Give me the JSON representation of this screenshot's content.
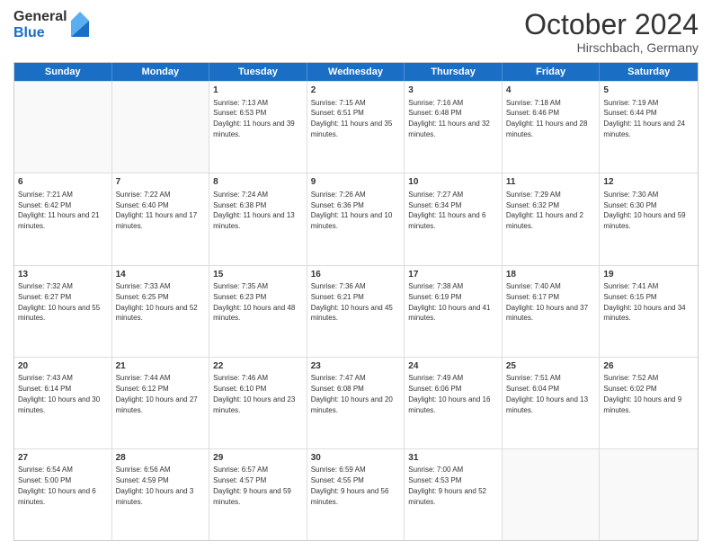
{
  "logo": {
    "general": "General",
    "blue": "Blue"
  },
  "header": {
    "month": "October 2024",
    "location": "Hirschbach, Germany"
  },
  "days": [
    "Sunday",
    "Monday",
    "Tuesday",
    "Wednesday",
    "Thursday",
    "Friday",
    "Saturday"
  ],
  "weeks": [
    [
      {
        "day": "",
        "empty": true
      },
      {
        "day": "",
        "empty": true
      },
      {
        "day": "1",
        "sunrise": "Sunrise: 7:13 AM",
        "sunset": "Sunset: 6:53 PM",
        "daylight": "Daylight: 11 hours and 39 minutes."
      },
      {
        "day": "2",
        "sunrise": "Sunrise: 7:15 AM",
        "sunset": "Sunset: 6:51 PM",
        "daylight": "Daylight: 11 hours and 35 minutes."
      },
      {
        "day": "3",
        "sunrise": "Sunrise: 7:16 AM",
        "sunset": "Sunset: 6:48 PM",
        "daylight": "Daylight: 11 hours and 32 minutes."
      },
      {
        "day": "4",
        "sunrise": "Sunrise: 7:18 AM",
        "sunset": "Sunset: 6:46 PM",
        "daylight": "Daylight: 11 hours and 28 minutes."
      },
      {
        "day": "5",
        "sunrise": "Sunrise: 7:19 AM",
        "sunset": "Sunset: 6:44 PM",
        "daylight": "Daylight: 11 hours and 24 minutes."
      }
    ],
    [
      {
        "day": "6",
        "sunrise": "Sunrise: 7:21 AM",
        "sunset": "Sunset: 6:42 PM",
        "daylight": "Daylight: 11 hours and 21 minutes."
      },
      {
        "day": "7",
        "sunrise": "Sunrise: 7:22 AM",
        "sunset": "Sunset: 6:40 PM",
        "daylight": "Daylight: 11 hours and 17 minutes."
      },
      {
        "day": "8",
        "sunrise": "Sunrise: 7:24 AM",
        "sunset": "Sunset: 6:38 PM",
        "daylight": "Daylight: 11 hours and 13 minutes."
      },
      {
        "day": "9",
        "sunrise": "Sunrise: 7:26 AM",
        "sunset": "Sunset: 6:36 PM",
        "daylight": "Daylight: 11 hours and 10 minutes."
      },
      {
        "day": "10",
        "sunrise": "Sunrise: 7:27 AM",
        "sunset": "Sunset: 6:34 PM",
        "daylight": "Daylight: 11 hours and 6 minutes."
      },
      {
        "day": "11",
        "sunrise": "Sunrise: 7:29 AM",
        "sunset": "Sunset: 6:32 PM",
        "daylight": "Daylight: 11 hours and 2 minutes."
      },
      {
        "day": "12",
        "sunrise": "Sunrise: 7:30 AM",
        "sunset": "Sunset: 6:30 PM",
        "daylight": "Daylight: 10 hours and 59 minutes."
      }
    ],
    [
      {
        "day": "13",
        "sunrise": "Sunrise: 7:32 AM",
        "sunset": "Sunset: 6:27 PM",
        "daylight": "Daylight: 10 hours and 55 minutes."
      },
      {
        "day": "14",
        "sunrise": "Sunrise: 7:33 AM",
        "sunset": "Sunset: 6:25 PM",
        "daylight": "Daylight: 10 hours and 52 minutes."
      },
      {
        "day": "15",
        "sunrise": "Sunrise: 7:35 AM",
        "sunset": "Sunset: 6:23 PM",
        "daylight": "Daylight: 10 hours and 48 minutes."
      },
      {
        "day": "16",
        "sunrise": "Sunrise: 7:36 AM",
        "sunset": "Sunset: 6:21 PM",
        "daylight": "Daylight: 10 hours and 45 minutes."
      },
      {
        "day": "17",
        "sunrise": "Sunrise: 7:38 AM",
        "sunset": "Sunset: 6:19 PM",
        "daylight": "Daylight: 10 hours and 41 minutes."
      },
      {
        "day": "18",
        "sunrise": "Sunrise: 7:40 AM",
        "sunset": "Sunset: 6:17 PM",
        "daylight": "Daylight: 10 hours and 37 minutes."
      },
      {
        "day": "19",
        "sunrise": "Sunrise: 7:41 AM",
        "sunset": "Sunset: 6:15 PM",
        "daylight": "Daylight: 10 hours and 34 minutes."
      }
    ],
    [
      {
        "day": "20",
        "sunrise": "Sunrise: 7:43 AM",
        "sunset": "Sunset: 6:14 PM",
        "daylight": "Daylight: 10 hours and 30 minutes."
      },
      {
        "day": "21",
        "sunrise": "Sunrise: 7:44 AM",
        "sunset": "Sunset: 6:12 PM",
        "daylight": "Daylight: 10 hours and 27 minutes."
      },
      {
        "day": "22",
        "sunrise": "Sunrise: 7:46 AM",
        "sunset": "Sunset: 6:10 PM",
        "daylight": "Daylight: 10 hours and 23 minutes."
      },
      {
        "day": "23",
        "sunrise": "Sunrise: 7:47 AM",
        "sunset": "Sunset: 6:08 PM",
        "daylight": "Daylight: 10 hours and 20 minutes."
      },
      {
        "day": "24",
        "sunrise": "Sunrise: 7:49 AM",
        "sunset": "Sunset: 6:06 PM",
        "daylight": "Daylight: 10 hours and 16 minutes."
      },
      {
        "day": "25",
        "sunrise": "Sunrise: 7:51 AM",
        "sunset": "Sunset: 6:04 PM",
        "daylight": "Daylight: 10 hours and 13 minutes."
      },
      {
        "day": "26",
        "sunrise": "Sunrise: 7:52 AM",
        "sunset": "Sunset: 6:02 PM",
        "daylight": "Daylight: 10 hours and 9 minutes."
      }
    ],
    [
      {
        "day": "27",
        "sunrise": "Sunrise: 6:54 AM",
        "sunset": "Sunset: 5:00 PM",
        "daylight": "Daylight: 10 hours and 6 minutes."
      },
      {
        "day": "28",
        "sunrise": "Sunrise: 6:56 AM",
        "sunset": "Sunset: 4:59 PM",
        "daylight": "Daylight: 10 hours and 3 minutes."
      },
      {
        "day": "29",
        "sunrise": "Sunrise: 6:57 AM",
        "sunset": "Sunset: 4:57 PM",
        "daylight": "Daylight: 9 hours and 59 minutes."
      },
      {
        "day": "30",
        "sunrise": "Sunrise: 6:59 AM",
        "sunset": "Sunset: 4:55 PM",
        "daylight": "Daylight: 9 hours and 56 minutes."
      },
      {
        "day": "31",
        "sunrise": "Sunrise: 7:00 AM",
        "sunset": "Sunset: 4:53 PM",
        "daylight": "Daylight: 9 hours and 52 minutes."
      },
      {
        "day": "",
        "empty": true
      },
      {
        "day": "",
        "empty": true
      }
    ]
  ]
}
